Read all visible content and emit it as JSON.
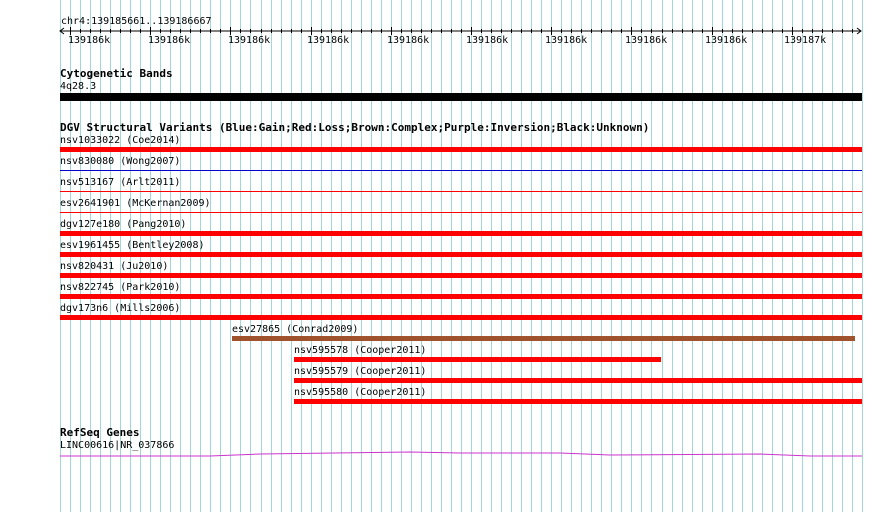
{
  "locus": "chr4:139185661..139186667",
  "ruler": {
    "ticks": [
      "139186k",
      "139186k",
      "139186k",
      "139186k",
      "139186k",
      "139186k",
      "139186k",
      "139186k",
      "139186k",
      "139187k"
    ]
  },
  "tracks": {
    "cytoband": {
      "title": "Cytogenetic Bands",
      "band": "4q28.3"
    },
    "dgv": {
      "title": "DGV Structural Variants (Blue:Gain;Red:Loss;Brown:Complex;Purple:Inversion;Black:Unknown)",
      "features": [
        {
          "name": "nsv1033022 (Coe2014)",
          "type": "Loss"
        },
        {
          "name": "nsv830080 (Wong2007)",
          "type": "Gain"
        },
        {
          "name": "nsv513167 (Arlt2011)",
          "type": "Loss"
        },
        {
          "name": "esv2641901 (McKernan2009)",
          "type": "Loss"
        },
        {
          "name": "dgv127e180 (Pang2010)",
          "type": "Loss"
        },
        {
          "name": "esv1961455 (Bentley2008)",
          "type": "Loss"
        },
        {
          "name": "nsv820431 (Ju2010)",
          "type": "Loss"
        },
        {
          "name": "nsv822745 (Park2010)",
          "type": "Loss"
        },
        {
          "name": "dgv173n6 (Mills2006)",
          "type": "Loss"
        },
        {
          "name": "esv27865 (Conrad2009)",
          "type": "Complex"
        },
        {
          "name": "nsv595578 (Cooper2011)",
          "type": "Loss"
        },
        {
          "name": "nsv595579 (Cooper2011)",
          "type": "Loss"
        },
        {
          "name": "nsv595580 (Cooper2011)",
          "type": "Loss"
        }
      ]
    },
    "refseq": {
      "title": "RefSeq Genes",
      "gene": "LINC00616|NR_037866"
    }
  },
  "colors": {
    "grid": "#a0d8d8",
    "loss": "#ff0000",
    "gain": "#0000cc",
    "complex": "#a0522d",
    "gene": "#cc33cc",
    "cytoband": "#000000"
  }
}
